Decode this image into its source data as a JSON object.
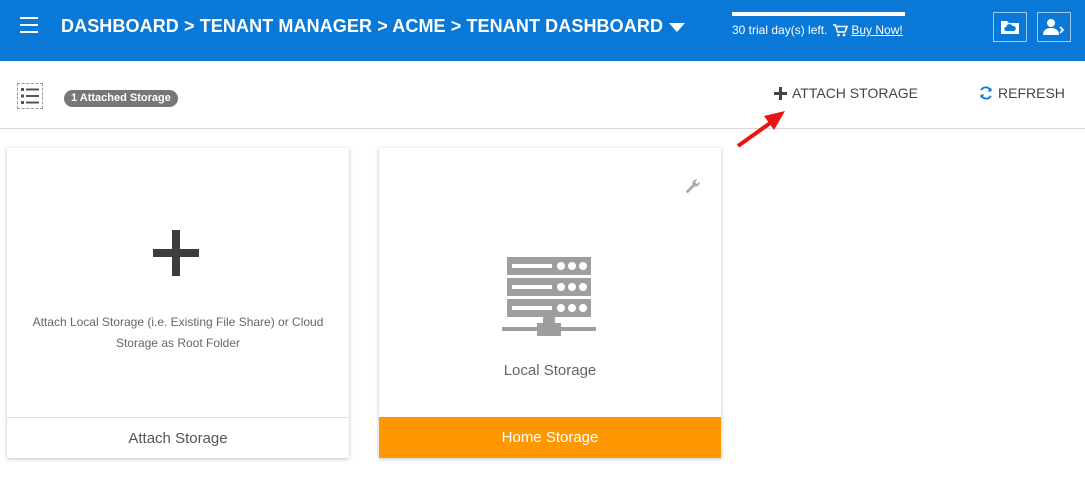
{
  "header": {
    "breadcrumb": "DASHBOARD > TENANT MANAGER > ACME > TENANT DASHBOARD",
    "trial_text": "30 trial day(s) left.",
    "buy_now": "Buy Now!"
  },
  "toolbar": {
    "badge": "1 Attached Storage",
    "attach_label": "ATTACH STORAGE",
    "refresh_label": "REFRESH"
  },
  "cards": [
    {
      "description": "Attach Local Storage (i.e. Existing File Share) or Cloud Storage as Root Folder",
      "footer": "Attach Storage"
    },
    {
      "label": "Local Storage",
      "footer": "Home Storage"
    }
  ],
  "colors": {
    "header_bg": "#0a78d6",
    "accent_orange": "#ff9800",
    "annotation_arrow": "#e81416"
  },
  "icons": [
    "menu-icon",
    "caret-down-icon",
    "cart-icon",
    "cloud-folder-icon",
    "user-icon",
    "list-view-icon",
    "plus-icon",
    "refresh-icon",
    "wrench-icon",
    "server-icon"
  ]
}
